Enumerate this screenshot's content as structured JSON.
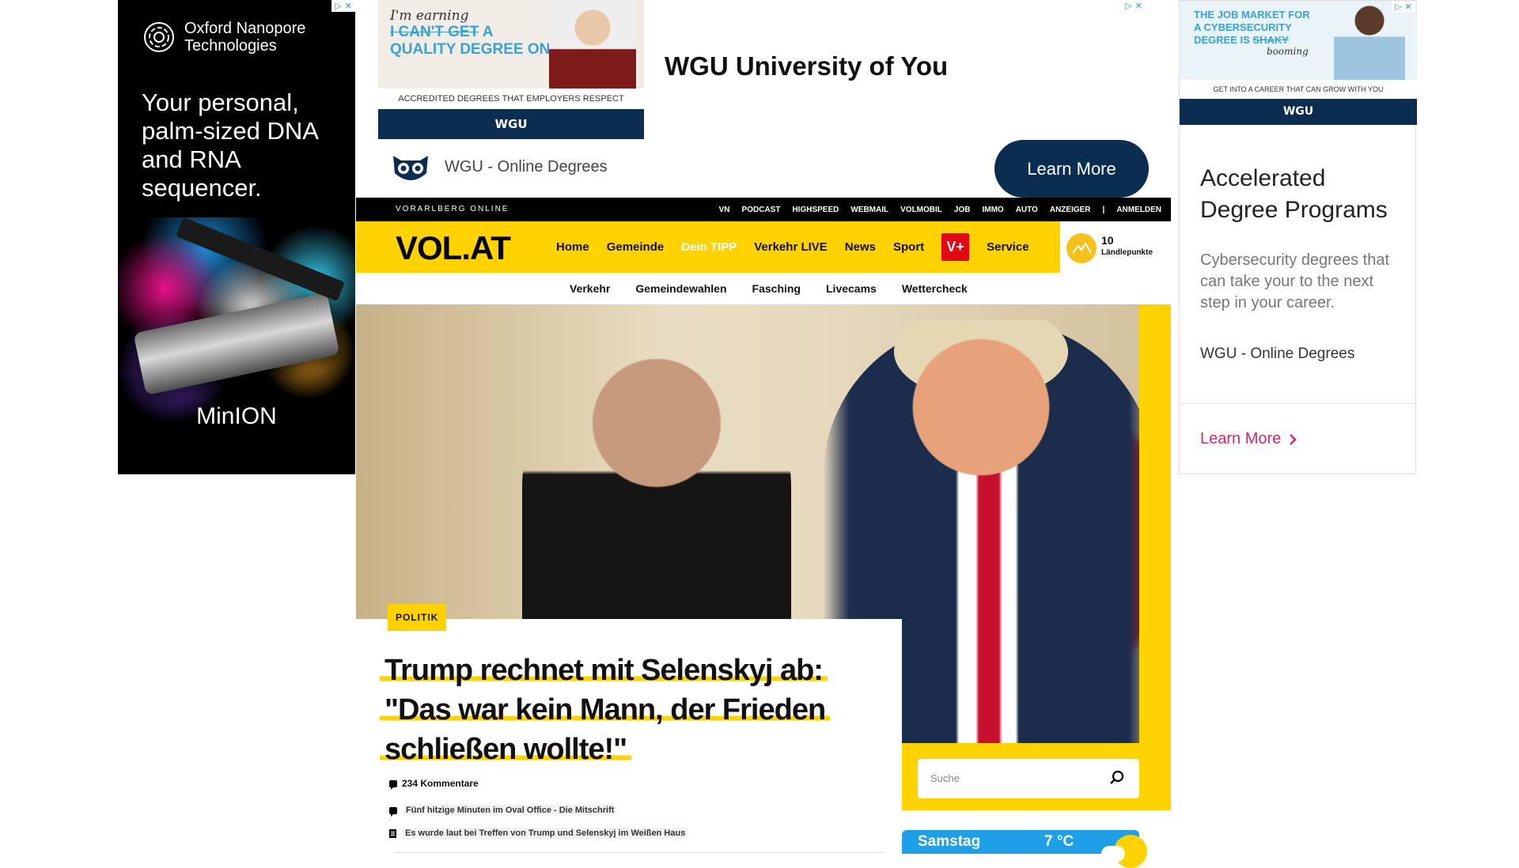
{
  "left_ad": {
    "brand_line1": "Oxford Nanopore",
    "brand_line2": "Technologies",
    "tagline": "Your personal, palm-sized DNA and RNA sequencer.",
    "product": "MinION"
  },
  "top_ad": {
    "creative_line1": "I'm earning",
    "creative_struck": "I CAN'T GET",
    "creative_a": " A",
    "creative_line3": "QUALITY DEGREE ONLINE",
    "creative_accredited": "ACCREDITED DEGREES THAT EMPLOYERS RESPECT",
    "creative_brand": "WGU",
    "headline": "WGU University of You",
    "advertiser": "WGU - Online Degrees",
    "cta": "Learn More"
  },
  "right_ad": {
    "creative_line1": "THE JOB MARKET FOR A CYBERSECURITY DEGREE IS",
    "creative_struck": "SHAKY",
    "creative_booming": "booming",
    "creative_getinto": "GET INTO A CAREER THAT CAN GROW WITH YOU",
    "creative_brand": "WGU",
    "headline": "Accelerated Degree Programs",
    "description": "Cybersecurity degrees that can take your to the next step in your career.",
    "advertiser": "WGU - Online Degrees",
    "cta": "Learn More"
  },
  "topbar": {
    "site_name": "VORARLBERG ONLINE",
    "links": [
      "VN",
      "PODCAST",
      "HIGHSPEED",
      "WEBMAIL",
      "VOLMOBIL",
      "JOB",
      "IMMO",
      "AUTO",
      "ANZEIGER",
      "|",
      "ANMELDEN"
    ]
  },
  "mainnav": {
    "logo": "VOL.AT",
    "items": [
      "Home",
      "Gemeinde",
      "Dein TIPP",
      "Verkehr LIVE",
      "News",
      "Sport",
      "V+",
      "Service"
    ],
    "points_value": "10",
    "points_label": "Ländlepunkte"
  },
  "subnav": {
    "items": [
      "Verkehr",
      "Gemeindewahlen",
      "Fasching",
      "Livecams",
      "Wettercheck"
    ]
  },
  "article": {
    "category": "POLITIK",
    "title_line1": "Trump rechnet mit Selenskyj ab:",
    "title_line2": "\"Das war kein Mann, der Frieden",
    "title_line3": "schließen wollte!\"",
    "comments": "234 Kommentare",
    "related": [
      "Fünf hitzige Minuten im Oval Office - Die Mitschrift",
      "Es wurde laut bei Treffen von Trump und Selenskyj im Weißen Haus"
    ]
  },
  "search": {
    "placeholder": "Suche"
  },
  "weather": {
    "day": "Samstag",
    "temp": "7 °C"
  },
  "colors": {
    "brand_yellow": "#ffd200",
    "wgu_navy": "#0b2d52",
    "vplus_red": "#e30613",
    "weather_blue": "#1fa0e6",
    "learn_more_pink": "#d6246e"
  }
}
